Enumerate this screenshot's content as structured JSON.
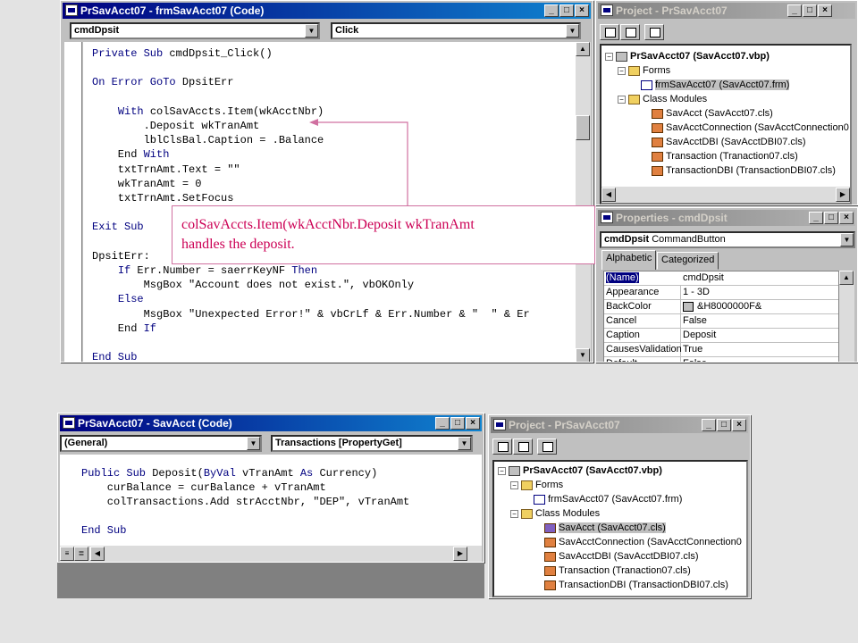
{
  "top_code_window": {
    "title": "PrSavAcct07 - frmSavAcct07 (Code)",
    "object_combo": "cmdDpsit",
    "proc_combo": "Click",
    "lines": [
      "Private Sub cmdDpsit_Click()",
      "",
      "On Error GoTo DpsitErr",
      "",
      "    With colSavAccts.Item(wkAcctNbr)",
      "        .Deposit wkTranAmt",
      "        lblClsBal.Caption = .Balance",
      "    End With",
      "    txtTrnAmt.Text = \"\"",
      "    wkTranAmt = 0",
      "    txtTrnAmt.SetFocus",
      "",
      "Exit Sub",
      "",
      "DpsitErr:",
      "    If Err.Number = saerrKeyNF Then",
      "        MsgBox \"Account does not exist.\", vbOKOnly",
      "    Else",
      "        MsgBox \"Unexpected Error!\" & vbCrLf & Err.Number & \"  \" & Er",
      "    End If",
      "",
      "End Sub"
    ]
  },
  "callout": {
    "line1": "colSavAccts.Item(wkAcctNbr.Deposit  wkTranAmt",
    "line2": "handles the deposit."
  },
  "top_project": {
    "title": "Project - PrSavAcct07",
    "root": "PrSavAcct07 (SavAcct07.vbp)",
    "forms_label": "Forms",
    "form_item": "frmSavAcct07 (SavAcct07.frm)",
    "class_label": "Class Modules",
    "classes": [
      "SavAcct (SavAcct07.cls)",
      "SavAcctConnection (SavAcctConnection0",
      "SavAcctDBI (SavAcctDBI07.cls)",
      "Transaction (Tranaction07.cls)",
      "TransactionDBI (TransactionDBI07.cls)"
    ]
  },
  "properties": {
    "title": "Properties - cmdDpsit",
    "object": "cmdDpsit",
    "object_type": "CommandButton",
    "tab_alpha": "Alphabetic",
    "tab_cat": "Categorized",
    "rows": [
      {
        "k": "(Name)",
        "v": "cmdDpsit"
      },
      {
        "k": "Appearance",
        "v": "1 - 3D"
      },
      {
        "k": "BackColor",
        "v": "&H8000000F&"
      },
      {
        "k": "Cancel",
        "v": "False"
      },
      {
        "k": "Caption",
        "v": "Deposit"
      },
      {
        "k": "CausesValidation",
        "v": "True"
      },
      {
        "k": "Default",
        "v": "False"
      }
    ]
  },
  "bottom_code_window": {
    "title": "PrSavAcct07 - SavAcct (Code)",
    "object_combo": "(General)",
    "proc_combo": "Transactions [PropertyGet]",
    "lines": [
      "Public Sub Deposit(ByVal vTranAmt As Currency)",
      "    curBalance = curBalance + vTranAmt",
      "    colTransactions.Add strAcctNbr, \"DEP\", vTranAmt",
      "",
      "End Sub"
    ]
  },
  "bottom_project": {
    "title": "Project - PrSavAcct07",
    "root": "PrSavAcct07 (SavAcct07.vbp)",
    "forms_label": "Forms",
    "form_item": "frmSavAcct07 (SavAcct07.frm)",
    "class_label": "Class Modules",
    "classes": [
      "SavAcct (SavAcct07.cls)",
      "SavAcctConnection (SavAcctConnection0",
      "SavAcctDBI (SavAcctDBI07.cls)",
      "Transaction (Tranaction07.cls)",
      "TransactionDBI (TransactionDBI07.cls)"
    ]
  },
  "colors": {
    "title_active": "#000080",
    "keyword": "#000080",
    "callout_text": "#cc0055",
    "callout_border": "#d070a0"
  }
}
